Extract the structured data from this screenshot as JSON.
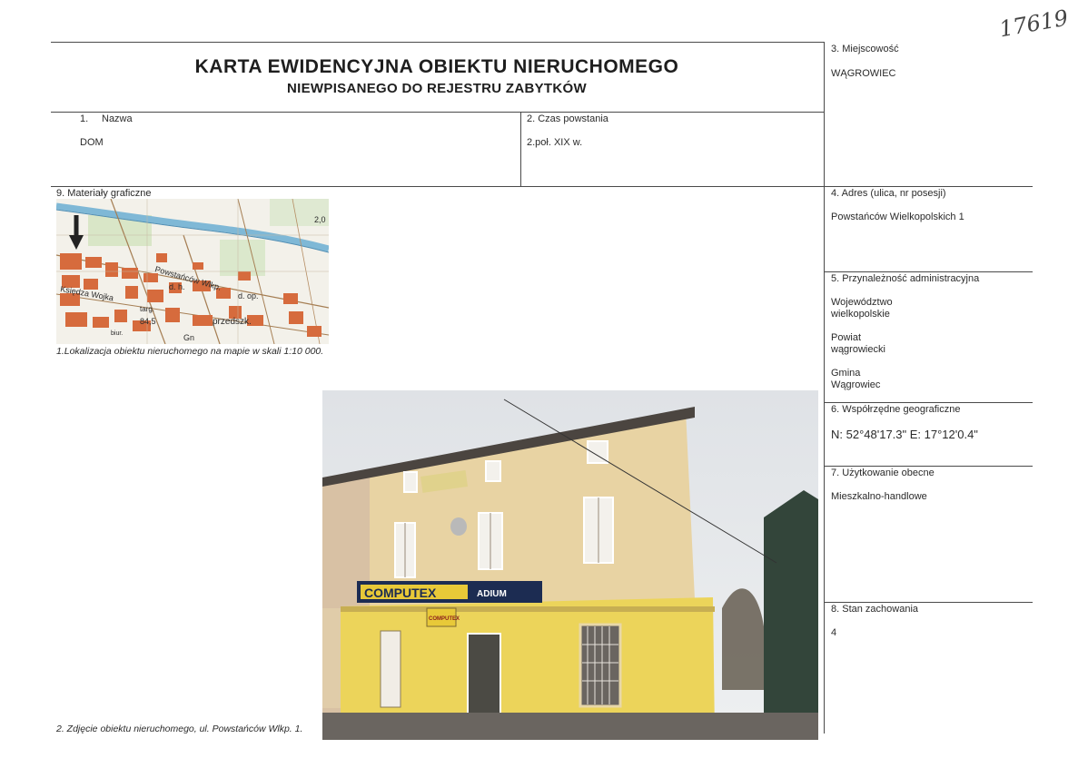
{
  "header": {
    "title": "KARTA EWIDENCYJNA OBIEKTU NIERUCHOMEGO",
    "subtitle": "NIEWPISANEGO DO REJESTRU ZABYTKÓW",
    "registry_number": "17619"
  },
  "fields": {
    "miejscowosc": {
      "label": "3. Miejscowość",
      "value": "WĄGROWIEC"
    },
    "nazwa": {
      "label_num": "1.",
      "label": "Nazwa",
      "value": "DOM"
    },
    "czas": {
      "label": "2. Czas powstania",
      "value": "2.poł.  XIX w."
    },
    "materialy": {
      "label": "9. Materiały graficzne"
    },
    "adres": {
      "label": "4. Adres (ulica, nr posesji)",
      "value": "Powstańców Wielkopolskich 1"
    },
    "przynaleznosc": {
      "label": "5. Przynależność administracyjna",
      "wojewodztwo_label": "Województwo",
      "wojewodztwo": "wielkopolskie",
      "powiat_label": "Powiat",
      "powiat": "wągrowiecki",
      "gmina_label": "Gmina",
      "gmina": "Wągrowiec"
    },
    "wspolrzedne": {
      "label": "6. Współrzędne geograficzne",
      "value": "N: 52°48'17.3\"  E: 17°12'0.4\""
    },
    "uzytkowanie": {
      "label": "7. Użytkowanie obecne",
      "value": "Mieszkalno-handlowe"
    },
    "stan": {
      "label": "8. Stan zachowania",
      "value": "4"
    }
  },
  "captions": {
    "map": "1.Lokalizacja obiektu nieruchomego na mapie w skali 1:10 000.",
    "photo": "2. Zdjęcie obiektu nieruchomego, ul. Powstańców Wlkp. 1."
  },
  "map_labels": {
    "street1": "Powstańców Wlkp.",
    "street2": "Księdza Wojka",
    "dh": "d. h.",
    "dop": "d. op.",
    "targ": "targ.",
    "elev": "84,5",
    "przedszk": "przedszk.",
    "grid": "2,0",
    "biur": "biur.",
    "gn": "Gn"
  },
  "photo_signs": {
    "shop": "COMPUTEX",
    "shop2": "ADIUM",
    "door_sign": "COMPUTEX"
  }
}
